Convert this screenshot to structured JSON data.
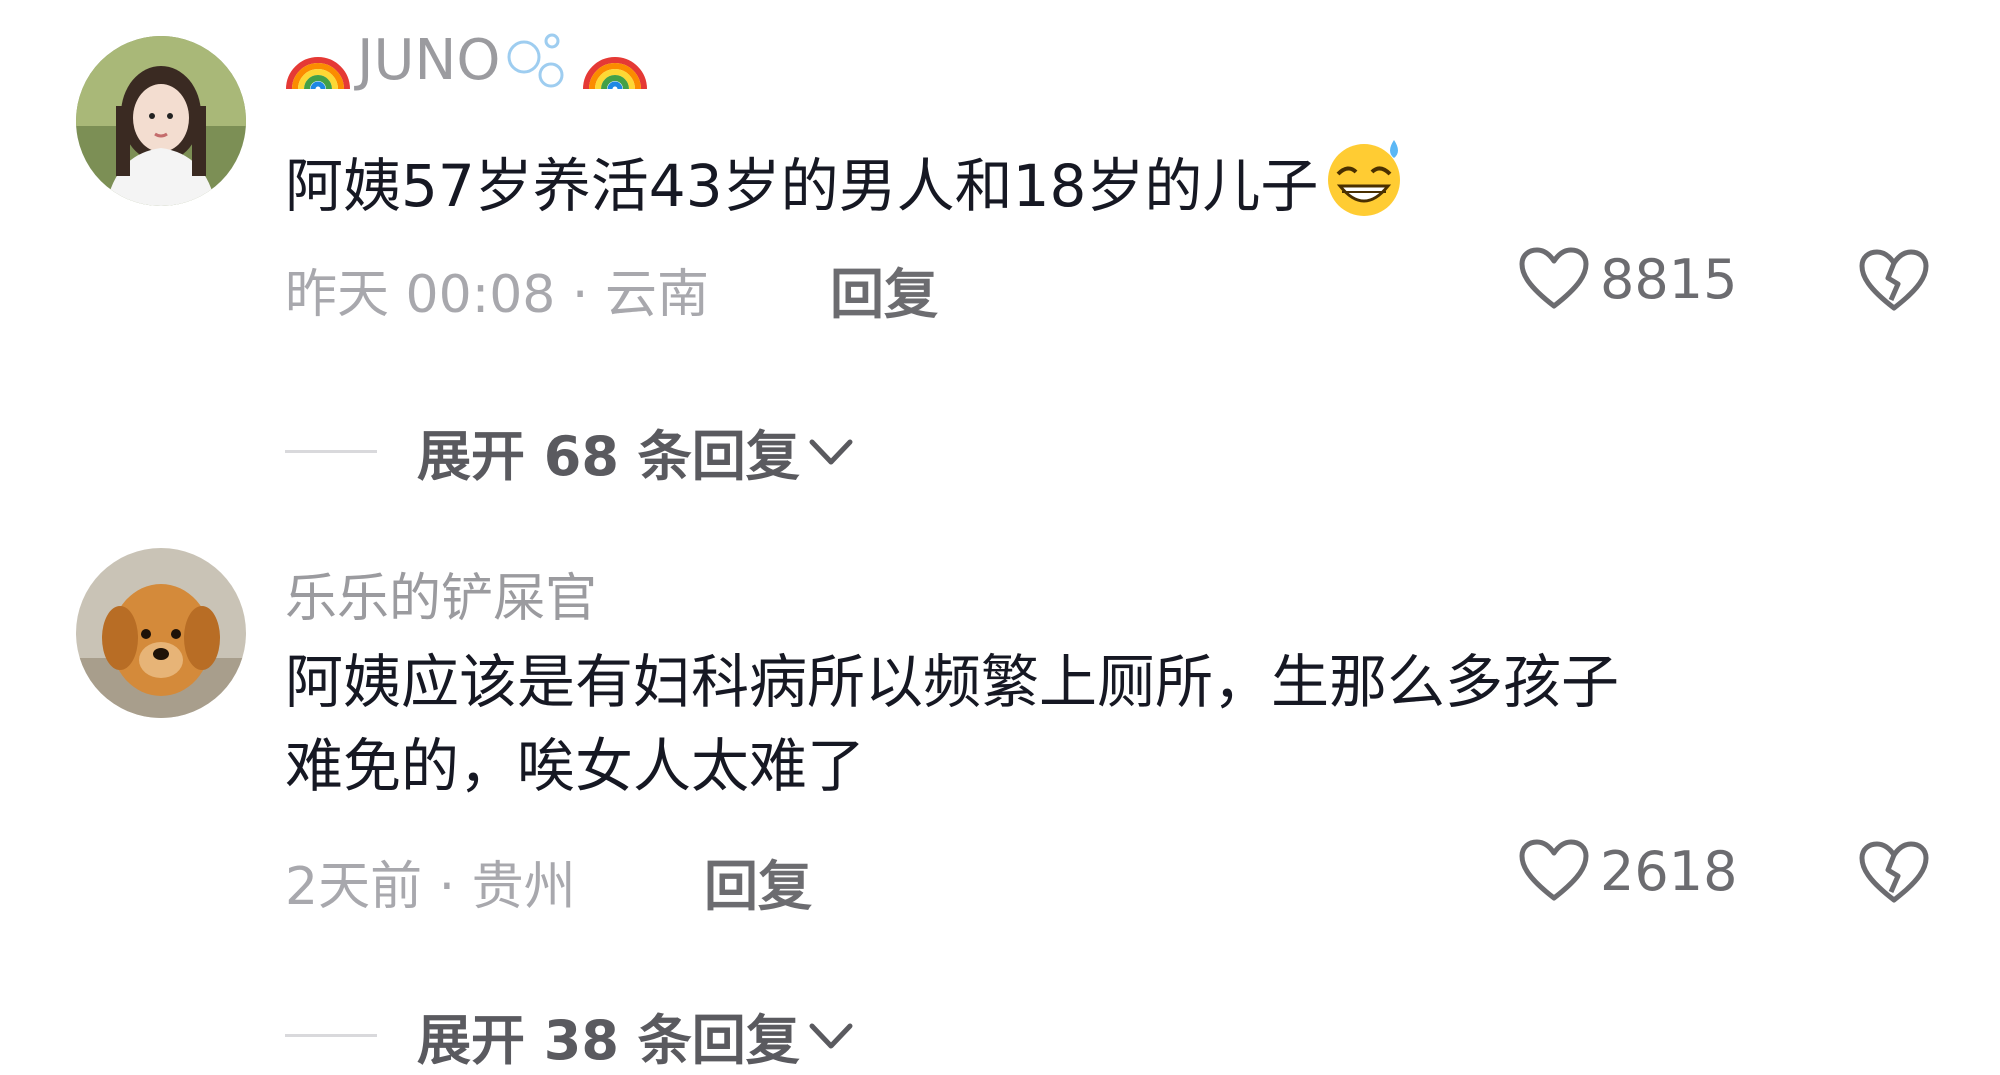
{
  "comments": [
    {
      "username_text": "JUNO",
      "username_icons": [
        "rainbow-icon",
        "bubbles-icon",
        "rainbow-icon"
      ],
      "text": "阿姨57岁养活43岁的男人和18岁的儿子",
      "emoji": "grinning-sweat-emoji",
      "time_location": "昨天 00:08 · 云南",
      "reply_label": "回复",
      "likes": "8815",
      "expand_label": "展开 68 条回复"
    },
    {
      "username_text": "乐乐的铲屎官",
      "text_line1": "阿姨应该是有妇科病所以频繁上厕所，生那么多孩子",
      "text_line2": "难免的，唉女人太难了",
      "time_location": "2天前 · 贵州",
      "reply_label": "回复",
      "likes": "2618",
      "expand_label": "展开 38 条回复"
    }
  ],
  "colors": {
    "text": "#161823",
    "meta": "#a8a8ad",
    "username": "#9b9b9f",
    "action": "#6c6c70"
  }
}
